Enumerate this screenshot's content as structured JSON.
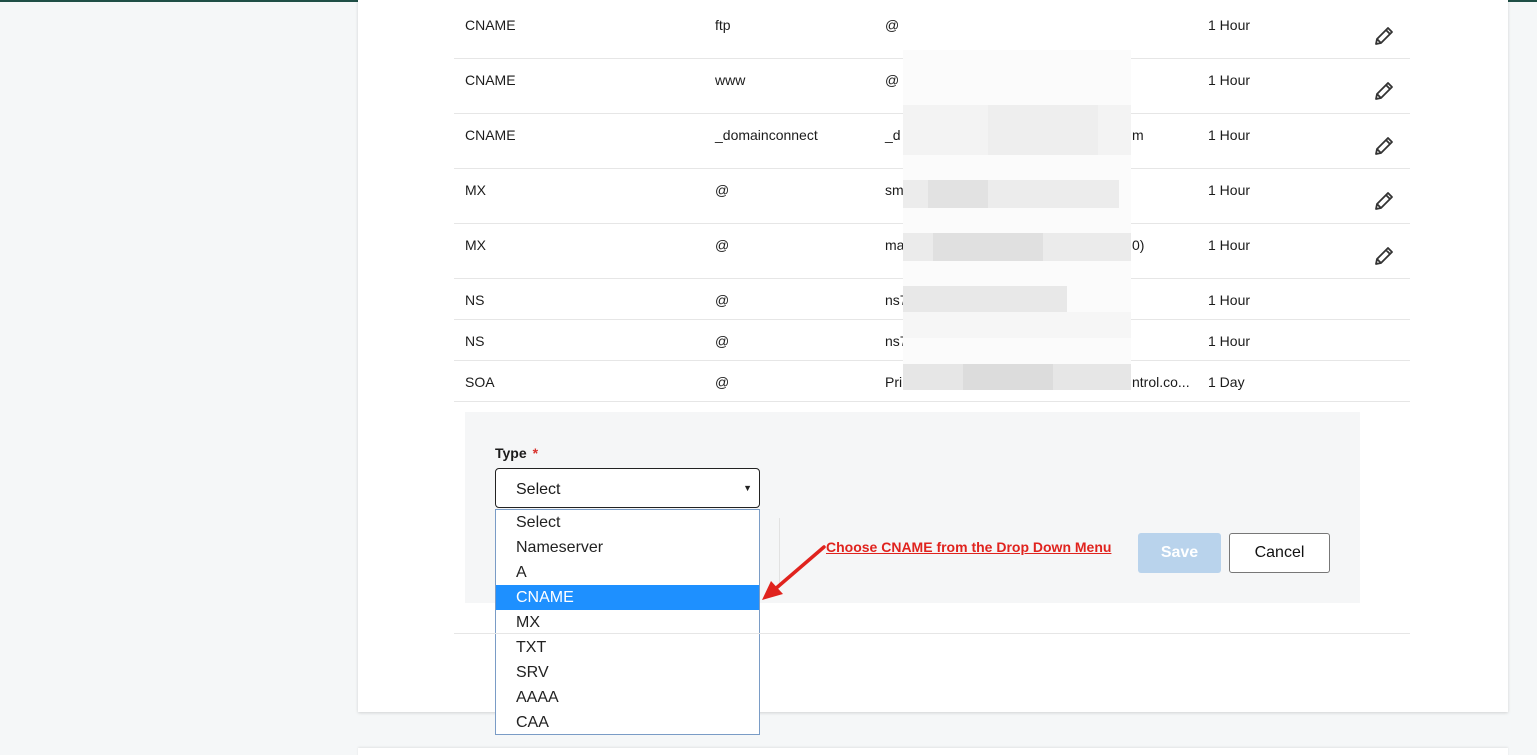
{
  "records": [
    {
      "type": "CNAME",
      "name": "ftp",
      "value": "@",
      "ttl": "1 Hour",
      "editable": true
    },
    {
      "type": "CNAME",
      "name": "www",
      "value": "@",
      "ttl": "1 Hour",
      "editable": true
    },
    {
      "type": "CNAME",
      "name": "_domainconnect",
      "value": "_d",
      "value_tail": "m",
      "ttl": "1 Hour",
      "editable": true
    },
    {
      "type": "MX",
      "name": "@",
      "value": "sm",
      "ttl": "1 Hour",
      "editable": true
    },
    {
      "type": "MX",
      "name": "@",
      "value": "ma",
      "value_tail": "0)",
      "ttl": "1 Hour",
      "editable": true
    },
    {
      "type": "NS",
      "name": "@",
      "value": "ns7",
      "ttl": "1 Hour",
      "editable": false
    },
    {
      "type": "NS",
      "name": "@",
      "value": "ns7",
      "ttl": "1 Hour",
      "editable": false
    },
    {
      "type": "SOA",
      "name": "@",
      "value": "Pri",
      "value_tail": "ntrol.co...",
      "ttl": "1 Day",
      "editable": false
    }
  ],
  "form": {
    "type_label": "Type",
    "required_mark": "*",
    "select_value": "Select",
    "options": [
      "Select",
      "Nameserver",
      "A",
      "CNAME",
      "MX",
      "TXT",
      "SRV",
      "AAAA",
      "CAA"
    ],
    "highlighted_option": "CNAME",
    "save_label": "Save",
    "cancel_label": "Cancel"
  },
  "annotation": {
    "text": "Choose CNAME from the Drop Down Menu",
    "color": "#e0231e"
  },
  "colors": {
    "highlight": "#1e90ff",
    "save_disabled": "#b9d3ec",
    "top_bar": "#1f4f46"
  },
  "icons": {
    "edit": "pencil-icon",
    "caret": "caret-down-icon",
    "arrow": "red-arrow-icon"
  }
}
